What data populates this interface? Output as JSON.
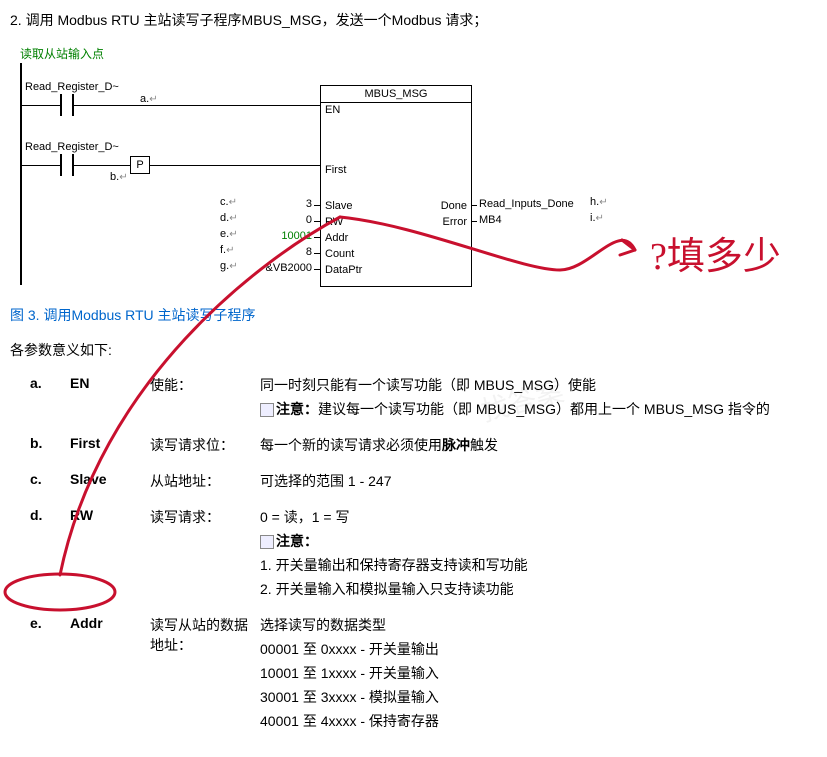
{
  "heading": "2. 调用 Modbus RTU 主站读写子程序MBUS_MSG，发送一个Modbus 请求；",
  "network_title": "读取从站输入点",
  "contact1_label": "Read_Register_D~",
  "contact2_label": "Read_Register_D~",
  "p_label": "P",
  "fb": {
    "title": "MBUS_MSG",
    "pins": {
      "en": "EN",
      "first": "First",
      "slave": "Slave",
      "rw": "RW",
      "addr": "Addr",
      "count": "Count",
      "dataptr": "DataPtr",
      "done": "Done",
      "error": "Error"
    },
    "vals": {
      "slave": "3",
      "rw": "0",
      "addr": "10001",
      "count": "8",
      "dataptr": "&VB2000"
    },
    "outs": {
      "done": "Read_Inputs_Done",
      "error": "MB4"
    }
  },
  "markers": {
    "a": "a.",
    "b": "b.",
    "c": "c.",
    "d": "d.",
    "e": "e.",
    "f": "f.",
    "g": "g.",
    "h": "h.",
    "i": "i."
  },
  "marker_sub": "↵",
  "fig_caption": "图 3. 调用Modbus RTU 主站读写子程序",
  "params_title": "各参数意义如下:",
  "params": [
    {
      "letter": "a.",
      "name": "EN",
      "label": "使能：",
      "desc": [
        "同一时刻只能有一个读写功能（即 MBUS_MSG）使能",
        "注意：建议每一个读写功能（即 MBUS_MSG）都用上一个 MBUS_MSG 指令的"
      ],
      "note_on": [
        1
      ]
    },
    {
      "letter": "b.",
      "name": "First",
      "label": "读写请求位：",
      "desc": [
        "每一个新的读写请求必须使用脉冲触发"
      ]
    },
    {
      "letter": "c.",
      "name": "Slave",
      "label": "从站地址：",
      "desc": [
        "可选择的范围  1 - 247"
      ]
    },
    {
      "letter": "d.",
      "name": "RW",
      "label": "读写请求：",
      "desc": [
        "0 = 读，1 = 写",
        "注意：",
        "1. 开关量输出和保持寄存器支持读和写功能",
        "2. 开关量输入和模拟量输入只支持读功能"
      ],
      "note_on": [
        1
      ]
    },
    {
      "letter": "e.",
      "name": "Addr",
      "label": "读写从站的数据地址：",
      "desc": [
        "选择读写的数据类型",
        "00001 至 0xxxx - 开关量输出",
        "10001 至 1xxxx - 开关量输入",
        "30001 至 3xxxx - 模拟量输入",
        "40001 至 4xxxx - 保持寄存器"
      ]
    }
  ],
  "handwriting": "?填多少"
}
